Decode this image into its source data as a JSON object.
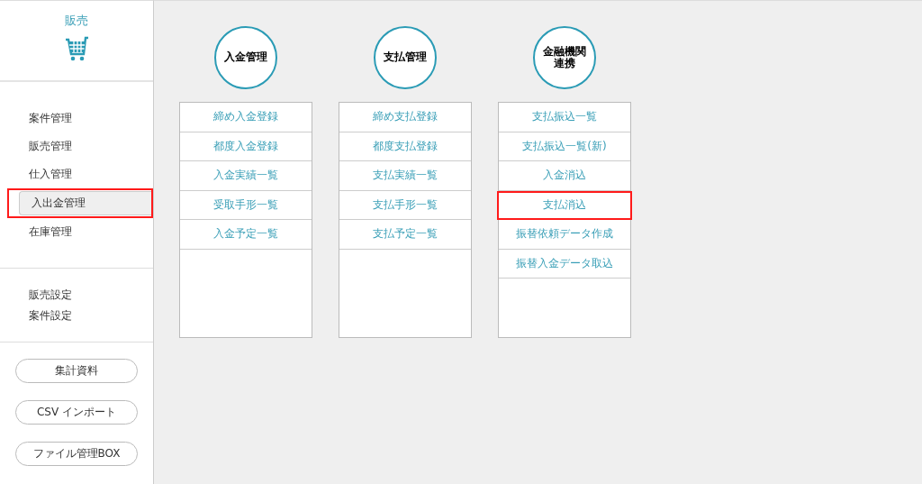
{
  "sidebar": {
    "title": "販売",
    "nav_items": [
      {
        "label": "案件管理",
        "selected": false,
        "highlighted": false
      },
      {
        "label": "販売管理",
        "selected": false,
        "highlighted": false
      },
      {
        "label": "仕入管理",
        "selected": false,
        "highlighted": false
      },
      {
        "label": "入出金管理",
        "selected": true,
        "highlighted": true
      },
      {
        "label": "在庫管理",
        "selected": false,
        "highlighted": false
      }
    ],
    "settings_items": [
      {
        "label": "販売設定"
      },
      {
        "label": "案件設定"
      }
    ],
    "buttons": [
      "集計資料",
      "CSV インポート",
      "ファイル管理BOX"
    ]
  },
  "columns": [
    {
      "title_lines": [
        "入金管理"
      ],
      "items": [
        {
          "label": "締め入金登録",
          "highlighted": false
        },
        {
          "label": "都度入金登録",
          "highlighted": false
        },
        {
          "label": "入金実績一覧",
          "highlighted": false
        },
        {
          "label": "受取手形一覧",
          "highlighted": false
        },
        {
          "label": "入金予定一覧",
          "highlighted": false
        }
      ]
    },
    {
      "title_lines": [
        "支払管理"
      ],
      "items": [
        {
          "label": "締め支払登録",
          "highlighted": false
        },
        {
          "label": "都度支払登録",
          "highlighted": false
        },
        {
          "label": "支払実績一覧",
          "highlighted": false
        },
        {
          "label": "支払手形一覧",
          "highlighted": false
        },
        {
          "label": "支払予定一覧",
          "highlighted": false
        }
      ]
    },
    {
      "title_lines": [
        "金融機関",
        "連携"
      ],
      "items": [
        {
          "label": "支払振込一覧",
          "highlighted": false
        },
        {
          "label": "支払振込一覧(新)",
          "highlighted": false
        },
        {
          "label": "入金消込",
          "highlighted": false
        },
        {
          "label": "支払消込",
          "highlighted": true
        },
        {
          "label": "振替依頼データ作成",
          "highlighted": false
        },
        {
          "label": "振替入金データ取込",
          "highlighted": false
        }
      ]
    }
  ]
}
